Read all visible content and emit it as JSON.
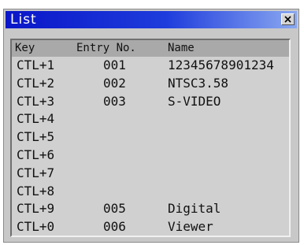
{
  "window": {
    "title": "List",
    "close_icon": "close-x-icon"
  },
  "list": {
    "columns": {
      "key": "Key",
      "entry": "Entry No.",
      "name": "Name"
    },
    "rows": [
      {
        "key": "CTL+1",
        "entry": "001",
        "name": "12345678901234"
      },
      {
        "key": "CTL+2",
        "entry": "002",
        "name": "NTSC3.58"
      },
      {
        "key": "CTL+3",
        "entry": "003",
        "name": "S-VIDEO"
      },
      {
        "key": "CTL+4",
        "entry": "",
        "name": ""
      },
      {
        "key": "CTL+5",
        "entry": "",
        "name": ""
      },
      {
        "key": "CTL+6",
        "entry": "",
        "name": ""
      },
      {
        "key": "CTL+7",
        "entry": "",
        "name": ""
      },
      {
        "key": "CTL+8",
        "entry": "",
        "name": ""
      },
      {
        "key": "CTL+9",
        "entry": "005",
        "name": "Digital"
      },
      {
        "key": "CTL+0",
        "entry": "006",
        "name": "Viewer"
      }
    ]
  }
}
